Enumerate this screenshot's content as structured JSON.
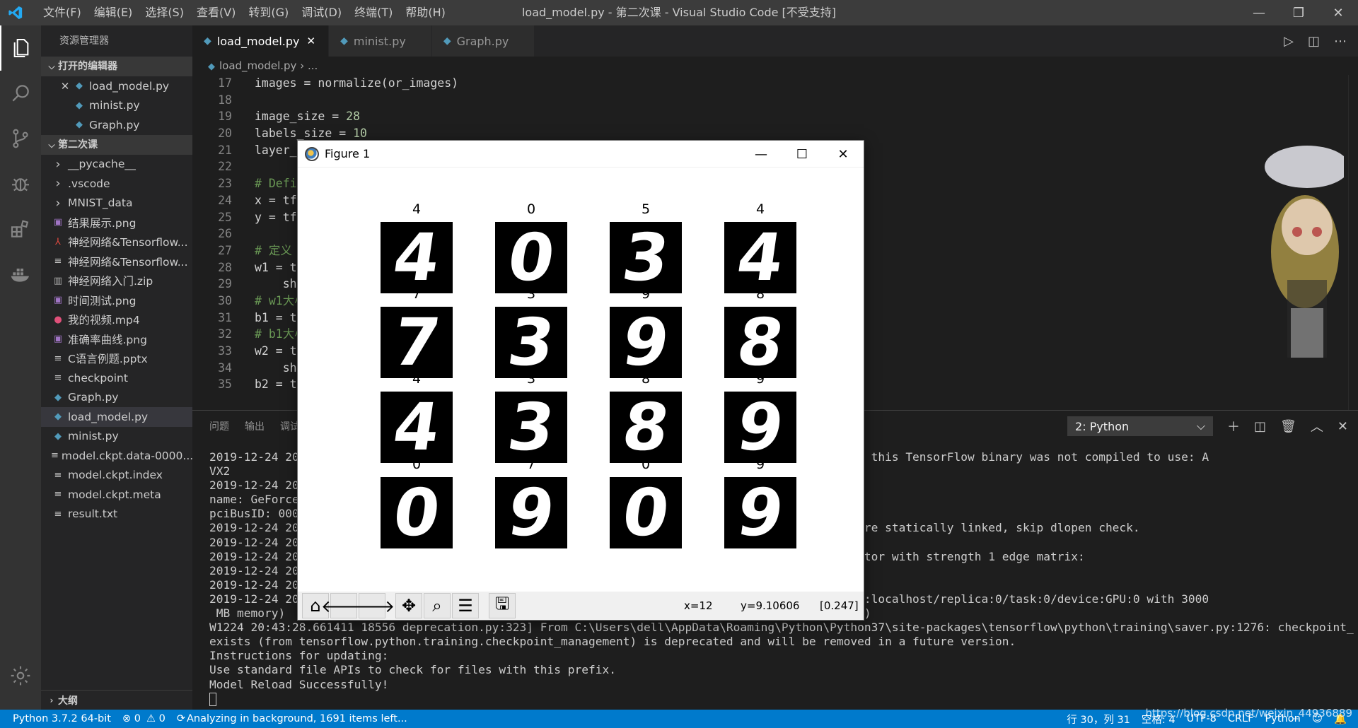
{
  "window": {
    "title": "load_model.py - 第二次课 - Visual Studio Code [不受支持]",
    "menu": [
      "文件(F)",
      "编辑(E)",
      "选择(S)",
      "查看(V)",
      "转到(G)",
      "调试(D)",
      "终端(T)",
      "帮助(H)"
    ],
    "minimize": "—",
    "maximize": "❐",
    "close": "✕"
  },
  "sidebar": {
    "header": "资源管理器",
    "open_editors": {
      "title": "打开的编辑器",
      "items": [
        "load_model.py",
        "minist.py",
        "Graph.py"
      ]
    },
    "folder": {
      "title": "第二次课",
      "items": [
        {
          "name": "__pycache__",
          "kind": "folder"
        },
        {
          "name": ".vscode",
          "kind": "folder"
        },
        {
          "name": "MNIST_data",
          "kind": "folder"
        },
        {
          "name": "结果展示.png",
          "kind": "image"
        },
        {
          "name": "神经网络&Tensorflow...",
          "kind": "pdf"
        },
        {
          "name": "神经网络&Tensorflow...",
          "kind": "text"
        },
        {
          "name": "神经网络入门.zip",
          "kind": "zip"
        },
        {
          "name": "时间测试.png",
          "kind": "image"
        },
        {
          "name": "我的视频.mp4",
          "kind": "video"
        },
        {
          "name": "准确率曲线.png",
          "kind": "image"
        },
        {
          "name": "C语言例题.pptx",
          "kind": "text"
        },
        {
          "name": "checkpoint",
          "kind": "text"
        },
        {
          "name": "Graph.py",
          "kind": "py"
        },
        {
          "name": "load_model.py",
          "kind": "py"
        },
        {
          "name": "minist.py",
          "kind": "py"
        },
        {
          "name": "model.ckpt.data-0000...",
          "kind": "text"
        },
        {
          "name": "model.ckpt.index",
          "kind": "text"
        },
        {
          "name": "model.ckpt.meta",
          "kind": "text"
        },
        {
          "name": "result.txt",
          "kind": "text"
        }
      ]
    },
    "outline": "大纲"
  },
  "tabs": [
    {
      "label": "load_model.py",
      "active": true
    },
    {
      "label": "minist.py",
      "active": false
    },
    {
      "label": "Graph.py",
      "active": false
    }
  ],
  "breadcrumb": {
    "file": "load_model.py",
    "rest": "..."
  },
  "code_lines": [
    {
      "n": "17",
      "t": "images = normalize(or_images)"
    },
    {
      "n": "18",
      "t": ""
    },
    {
      "n": "19",
      "t": "image_size = ",
      "num": "28"
    },
    {
      "n": "20",
      "t": "labels_size = ",
      "num": "10"
    },
    {
      "n": "21",
      "t": "layer_s"
    },
    {
      "n": "22",
      "t": ""
    },
    {
      "n": "23",
      "t": "# Defi",
      "comment": true
    },
    {
      "n": "24",
      "t": "x = tf."
    },
    {
      "n": "25",
      "t": "y = tf."
    },
    {
      "n": "26",
      "t": ""
    },
    {
      "n": "27",
      "t": "# 定义",
      "comment": true
    },
    {
      "n": "28",
      "t": "w1 = tf"
    },
    {
      "n": "29",
      "t": "    sha"
    },
    {
      "n": "30",
      "t": "# w1大小",
      "comment": true
    },
    {
      "n": "31",
      "t": "b1 = tf"
    },
    {
      "n": "32",
      "t": "# b1大小",
      "comment": true
    },
    {
      "n": "33",
      "t": "w2 = tf"
    },
    {
      "n": "34",
      "t": "    sha"
    },
    {
      "n": "35",
      "t": "b2 = tf"
    }
  ],
  "panel": {
    "tabs": [
      "问题",
      "输出",
      "调试"
    ],
    "terminal_select": "2: Python",
    "lines": [
      "2019-12-24 20                                                              ts instructions that this TensorFlow binary was not compiled to use: A",
      "VX2",
      "2019-12-24 20                                                              e 0 with properties:",
      "name: GeForce",
      "pciBusID: 000",
      "2019-12-24 20                                                              :25] GPU libraries are statically linked, skip dlopen check.",
      "2019-12-24 20                                                              ble gpu devices: 0",
      "2019-12-24 20                                                              rconnect StreamExecutor with strength 1 edge matrix:",
      "2019-12-24 20",
      "2019-12-24 20",
      "2019-12-24 20                                                              sorFlow device (/job:localhost/replica:0/task:0/device:GPU:0 with 3000",
      " MB memory)                                                                pute capability: 6.1)",
      "W1224 20:43:28.661411 18556 deprecation.py:323] From C:\\Users\\dell\\AppData\\Roaming\\Python\\Python37\\site-packages\\tensorflow\\python\\training\\saver.py:1276: checkpoint_",
      "exists (from tensorflow.python.training.checkpoint_management) is deprecated and will be removed in a future version.",
      "Instructions for updating:",
      "Use standard file APIs to check for files with this prefix.",
      "Model Reload Successfully!"
    ]
  },
  "statusbar": {
    "python": "Python 3.7.2 64-bit",
    "errors": "⊗ 0",
    "warnings": "⚠ 0",
    "analyzing": "Analyzing in background, 1691 items left...",
    "position": "行 30，列 31",
    "spaces": "空格: 4",
    "encoding": "UTF-8",
    "eol": "CRLF",
    "language": "Python",
    "watermark": "https://blog.csdn.net/weixin_44936889"
  },
  "figure": {
    "title": "Figure 1",
    "digits": [
      {
        "label": "4",
        "shown": "4"
      },
      {
        "label": "0",
        "shown": "0"
      },
      {
        "label": "5",
        "shown": "3"
      },
      {
        "label": "4",
        "shown": "4"
      },
      {
        "label": "7",
        "shown": "7"
      },
      {
        "label": "3",
        "shown": "3"
      },
      {
        "label": "9",
        "shown": "9"
      },
      {
        "label": "8",
        "shown": "8"
      },
      {
        "label": "4",
        "shown": "4"
      },
      {
        "label": "3",
        "shown": "3"
      },
      {
        "label": "8",
        "shown": "8"
      },
      {
        "label": "9",
        "shown": "9"
      },
      {
        "label": "0",
        "shown": "0"
      },
      {
        "label": "7",
        "shown": "9"
      },
      {
        "label": "0",
        "shown": "0"
      },
      {
        "label": "9",
        "shown": "9"
      }
    ],
    "toolbar": {
      "home": "⌂",
      "back": "🡐",
      "forward": "🡒",
      "pan": "✥",
      "zoom": "⌕",
      "configure": "☰",
      "save": "🖫"
    },
    "status_x": "x=12",
    "status_y": "y=9.10606",
    "status_val": "[0.247]"
  }
}
